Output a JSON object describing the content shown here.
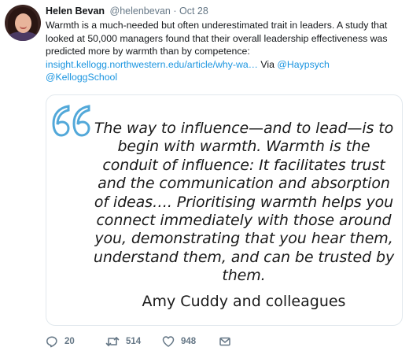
{
  "tweet": {
    "author": {
      "name": "Helen Bevan",
      "handle": "@helenbevan",
      "separator": "·",
      "date": "Oct 28"
    },
    "body": {
      "text": "Warmth is a much-needed but often underestimated trait in leaders. A study that looked at 50,000 managers found that their overall leadership effectiveness was predicted more by warmth than by competence:",
      "link": "insight.kellogg.northwestern.edu/article/why-wa…",
      "via": "Via",
      "mention_1": "@Haypsych",
      "mention_2": "@KelloggSchool"
    },
    "card": {
      "quote_lines": [
        "The way to influence—and to lead—is to",
        "begin with warmth. Warmth is the",
        "conduit of influence: It facilitates trust",
        "and the communication and absorption",
        "of ideas…. Prioritising warmth helps you",
        "connect immediately with those around",
        "you, demonstrating that you hear them,",
        "understand them, and can be trusted by",
        "them."
      ],
      "author": "Amy Cuddy and colleagues",
      "quote_color": "#52a8d9"
    },
    "actions": {
      "replies": "20",
      "retweets": "514",
      "likes": "948",
      "reply_icon": "reply-icon",
      "retweet_icon": "retweet-icon",
      "like_icon": "heart-icon",
      "dm_icon": "envelope-icon"
    },
    "colors": {
      "link": "#1b95e0",
      "muted": "#657786",
      "text": "#14171a"
    }
  }
}
